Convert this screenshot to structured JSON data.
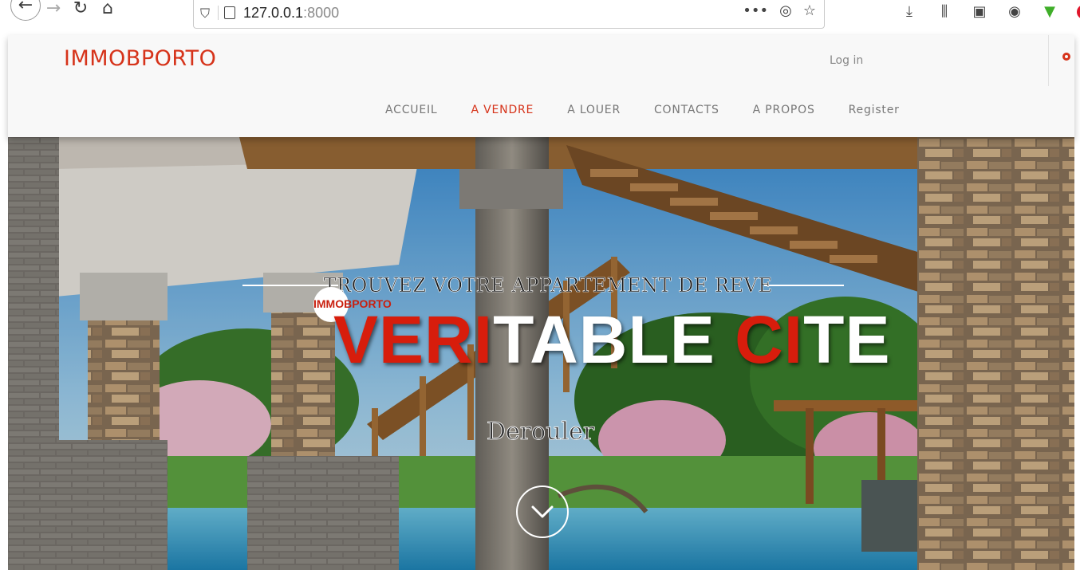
{
  "browser": {
    "url_host": "127.0.0.1",
    "url_port": ":8000",
    "icons": [
      "back-arrow-icon",
      "forward-arrow-icon",
      "reload-icon",
      "home-icon",
      "shield-icon",
      "page-icon",
      "more-icon",
      "pocket-icon",
      "star-icon",
      "download-icon",
      "library-icon",
      "sidebar-icon",
      "extension-icon",
      "green-extension-icon",
      "pinterest-icon"
    ]
  },
  "header": {
    "logo": "IMMOBPORTO",
    "login": "Log in",
    "nav": [
      {
        "label": "ACCUEIL",
        "active": false
      },
      {
        "label": "A VENDRE",
        "active": true
      },
      {
        "label": "A LOUER",
        "active": false
      },
      {
        "label": "CONTACTS",
        "active": false
      },
      {
        "label": "A PROPOS",
        "active": false
      },
      {
        "label": "Register",
        "active": false
      }
    ]
  },
  "hero": {
    "tagline": "TROUVEZ VOTRE APPARTEMENT DE REVE",
    "brand": "IMMOBPORTO",
    "title_parts": [
      {
        "text": "VERI",
        "accent": true
      },
      {
        "text": "TABLE ",
        "accent": false
      },
      {
        "text": "CI",
        "accent": true
      },
      {
        "text": "TE",
        "accent": false
      }
    ],
    "scroll_label": "Derouler"
  },
  "colors": {
    "accent": "#d6331a",
    "header_bg": "#f8f8f8",
    "nav_text": "#777777"
  }
}
